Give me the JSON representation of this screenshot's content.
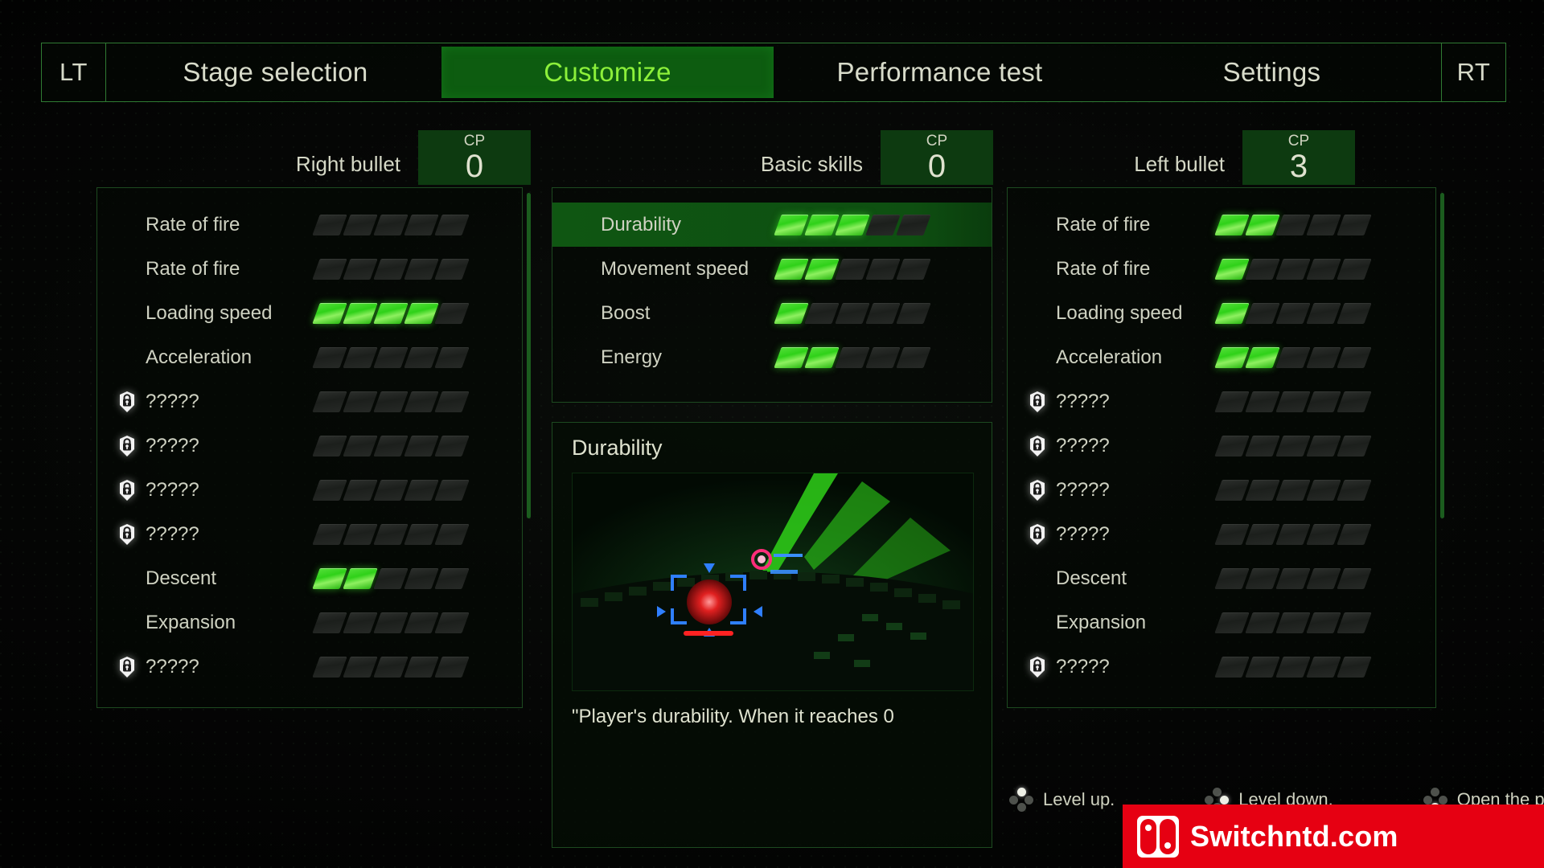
{
  "nav": {
    "left_trigger": "LT",
    "right_trigger": "RT",
    "items": [
      {
        "label": "Stage selection",
        "active": false
      },
      {
        "label": "Customize",
        "active": true
      },
      {
        "label": "Performance test",
        "active": false
      },
      {
        "label": "Settings",
        "active": false
      }
    ]
  },
  "columns": {
    "right_bullet": {
      "title": "Right bullet",
      "cp_label": "CP",
      "cp_value": "0",
      "max_segments": 5,
      "rows": [
        {
          "name": "Rate of fire",
          "locked": false,
          "filled": 0
        },
        {
          "name": "Rate of fire",
          "locked": false,
          "filled": 0
        },
        {
          "name": "Loading speed",
          "locked": false,
          "filled": 4
        },
        {
          "name": "Acceleration",
          "locked": false,
          "filled": 0
        },
        {
          "name": "?????",
          "locked": true,
          "filled": 0
        },
        {
          "name": "?????",
          "locked": true,
          "filled": 0
        },
        {
          "name": "?????",
          "locked": true,
          "filled": 0
        },
        {
          "name": "?????",
          "locked": true,
          "filled": 0
        },
        {
          "name": "Descent",
          "locked": false,
          "filled": 2
        },
        {
          "name": "Expansion",
          "locked": false,
          "filled": 0
        },
        {
          "name": "?????",
          "locked": true,
          "filled": 0
        }
      ]
    },
    "basic_skills": {
      "title": "Basic skills",
      "cp_label": "CP",
      "cp_value": "0",
      "max_segments": 5,
      "rows": [
        {
          "name": "Durability",
          "locked": false,
          "filled": 3,
          "selected": true
        },
        {
          "name": "Movement speed",
          "locked": false,
          "filled": 2,
          "selected": false
        },
        {
          "name": "Boost",
          "locked": false,
          "filled": 1,
          "selected": false
        },
        {
          "name": "Energy",
          "locked": false,
          "filled": 2,
          "selected": false
        }
      ]
    },
    "left_bullet": {
      "title": "Left bullet",
      "cp_label": "CP",
      "cp_value": "3",
      "max_segments": 5,
      "rows": [
        {
          "name": "Rate of fire",
          "locked": false,
          "filled": 2
        },
        {
          "name": "Rate of fire",
          "locked": false,
          "filled": 1
        },
        {
          "name": "Loading speed",
          "locked": false,
          "filled": 1
        },
        {
          "name": "Acceleration",
          "locked": false,
          "filled": 2
        },
        {
          "name": "?????",
          "locked": true,
          "filled": 0
        },
        {
          "name": "?????",
          "locked": true,
          "filled": 0
        },
        {
          "name": "?????",
          "locked": true,
          "filled": 0
        },
        {
          "name": "?????",
          "locked": true,
          "filled": 0
        },
        {
          "name": "Descent",
          "locked": false,
          "filled": 0
        },
        {
          "name": "Expansion",
          "locked": false,
          "filled": 0
        },
        {
          "name": "?????",
          "locked": true,
          "filled": 0
        }
      ]
    }
  },
  "detail": {
    "title": "Durability",
    "caption": "\"Player's durability. When it reaches 0"
  },
  "hints": [
    {
      "label": "Level up.",
      "dir": "up"
    },
    {
      "label": "Level down.",
      "dir": "right"
    },
    {
      "label": "Open the preset.",
      "dir": "down"
    }
  ],
  "watermark": {
    "text": "Switchntd.com"
  },
  "colors": {
    "accent_green": "#2fd119",
    "active_tab_bg": "#0d5c10",
    "active_tab_text": "#8cf03a",
    "cp_box_bg": "#0d3a10",
    "panel_border": "#1d4a20",
    "text": "#d5d8c6",
    "watermark_red": "#e60012"
  }
}
